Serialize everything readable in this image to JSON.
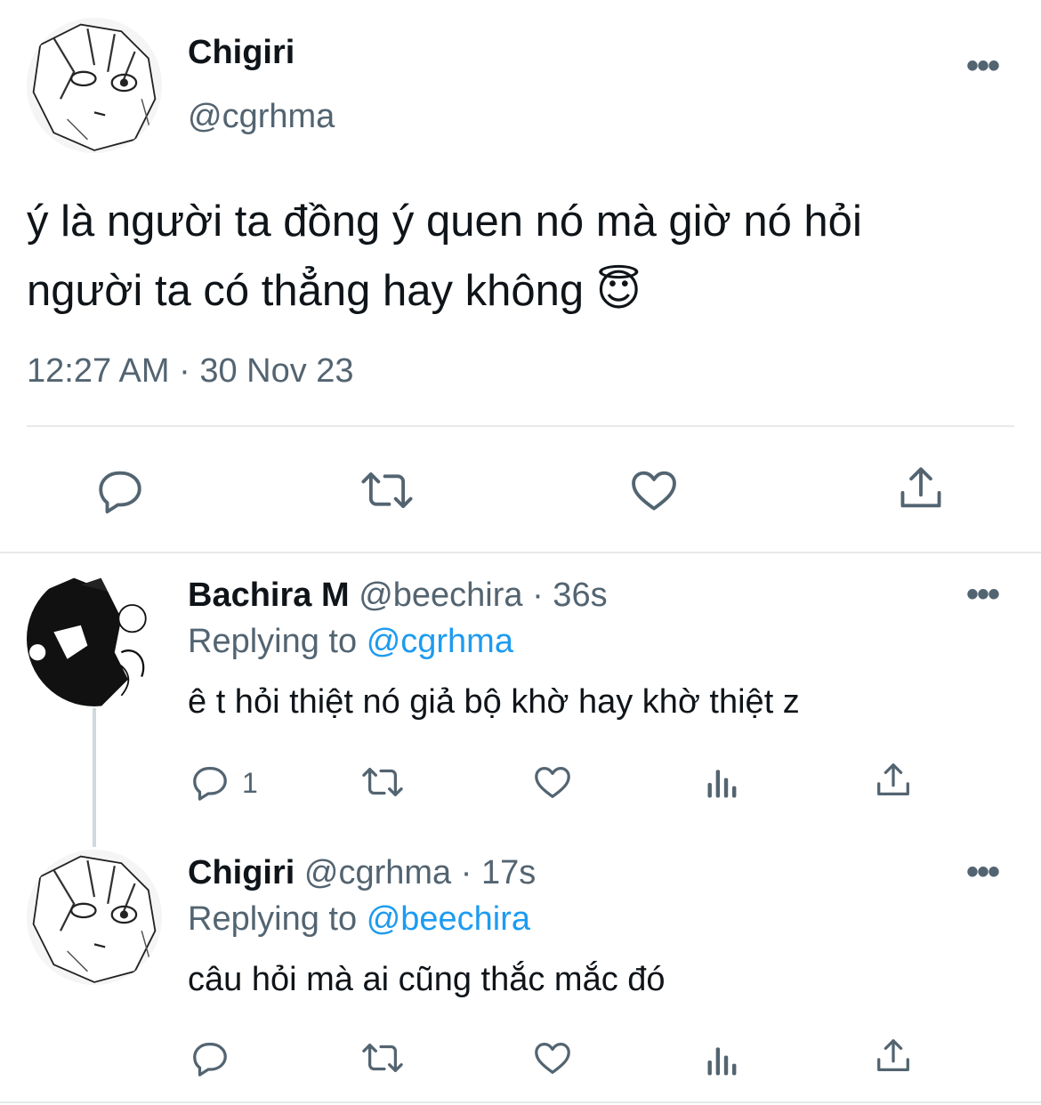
{
  "main_tweet": {
    "name": "Chigiri",
    "handle": "@cgrhma",
    "text_line1": "ý là người ta đồng ý quen nó mà giờ nó hỏi",
    "text_line2": "người ta có thẳng hay không",
    "emoji": "😇",
    "timestamp": "12:27 AM · 30 Nov 23",
    "more": "•••",
    "actions": [
      "reply-icon",
      "retweet-icon",
      "like-icon",
      "share-icon"
    ]
  },
  "replies": [
    {
      "name": "Bachira M",
      "handle": "@beechira",
      "time": "· 36s",
      "replying_label": "Replying to",
      "replying_to": "@cgrhma",
      "text": "ê t hỏi thiệt nó giả bộ khờ hay khờ thiệt z",
      "reply_count": "1",
      "more": "•••",
      "actions": [
        "reply-icon",
        "retweet-icon",
        "like-icon",
        "views-icon",
        "share-icon"
      ]
    },
    {
      "name": "Chigiri",
      "handle": "@cgrhma",
      "time": "· 17s",
      "replying_label": "Replying to",
      "replying_to": "@beechira",
      "text": "câu hỏi mà ai cũng thắc mắc đó",
      "reply_count": "",
      "more": "•••",
      "actions": [
        "reply-icon",
        "retweet-icon",
        "like-icon",
        "views-icon",
        "share-icon"
      ]
    }
  ],
  "colors": {
    "text": "#0f1419",
    "muted": "#536471",
    "link": "#1d9bf0",
    "divider": "#e7e9ea"
  }
}
